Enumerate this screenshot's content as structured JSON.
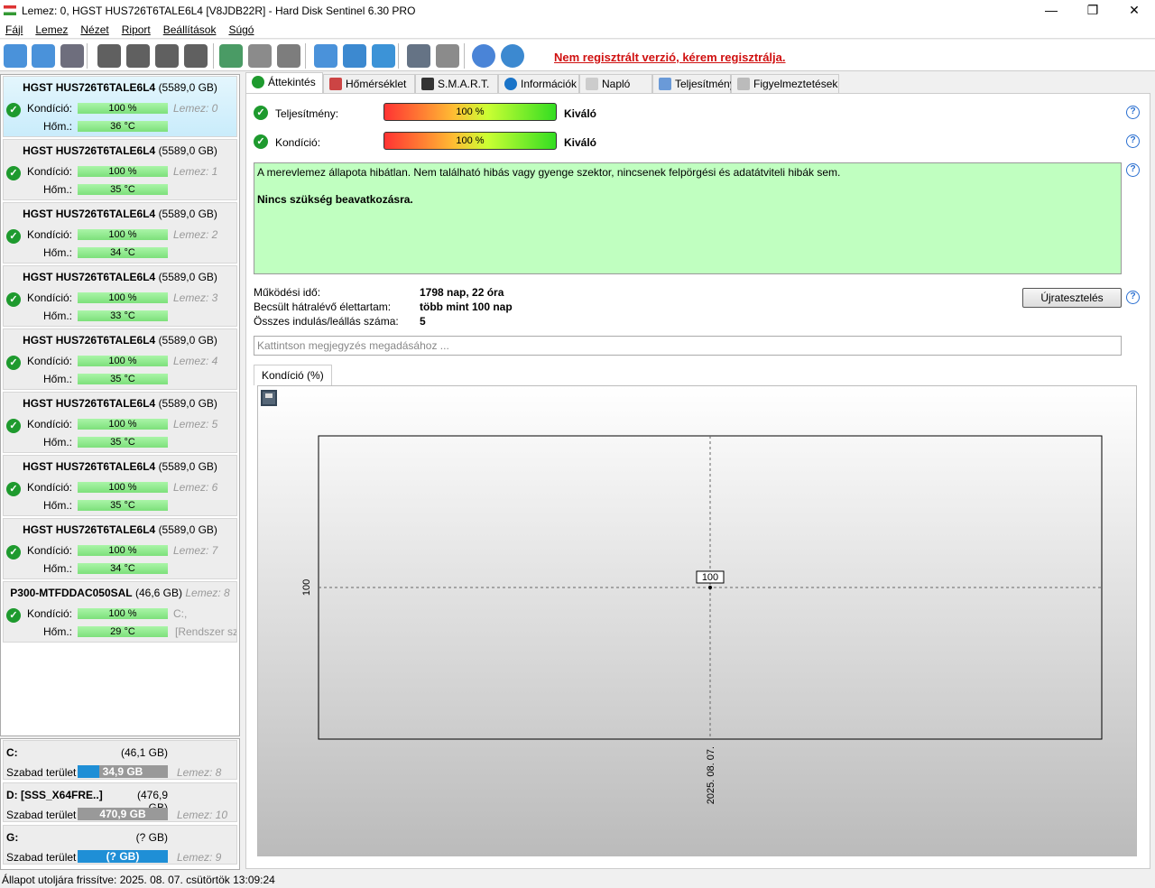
{
  "window": {
    "title": "Lemez: 0, HGST HUS726T6TALE6L4 [V8JDB22R]  -  Hard Disk Sentinel 6.30 PRO",
    "minimize": "—",
    "maximize": "❐",
    "close": "✕"
  },
  "menu": [
    "Fájl",
    "Lemez",
    "Nézet",
    "Riport",
    "Beállítások",
    "Súgó"
  ],
  "toolbar": {
    "icons": [
      "refresh-icon",
      "refresh-warning-icon",
      "disk-icon",
      "disk-sound-icon",
      "disk-clock-icon",
      "disk-check-icon",
      "disk-search-icon",
      "globe-disk-icon",
      "network-disk-icon",
      "usb-disk-icon",
      "notepad-icon",
      "mail-icon",
      "network-icon",
      "gear-icon",
      "speaker-icon",
      "help-icon",
      "info-icon"
    ],
    "registration": "Nem regisztrált verzió, kérem regisztrálja."
  },
  "disks": [
    {
      "name": "HGST HUS726T6TALE6L4",
      "size": "(5589,0 GB)",
      "condition": "100 %",
      "temp": "36 °C",
      "disk": "Lemez: 0"
    },
    {
      "name": "HGST HUS726T6TALE6L4",
      "size": "(5589,0 GB)",
      "condition": "100 %",
      "temp": "35 °C",
      "disk": "Lemez: 1"
    },
    {
      "name": "HGST HUS726T6TALE6L4",
      "size": "(5589,0 GB)",
      "condition": "100 %",
      "temp": "34 °C",
      "disk": "Lemez: 2"
    },
    {
      "name": "HGST HUS726T6TALE6L4",
      "size": "(5589,0 GB)",
      "condition": "100 %",
      "temp": "33 °C",
      "disk": "Lemez: 3"
    },
    {
      "name": "HGST HUS726T6TALE6L4",
      "size": "(5589,0 GB)",
      "condition": "100 %",
      "temp": "35 °C",
      "disk": "Lemez: 4"
    },
    {
      "name": "HGST HUS726T6TALE6L4",
      "size": "(5589,0 GB)",
      "condition": "100 %",
      "temp": "35 °C",
      "disk": "Lemez: 5"
    },
    {
      "name": "HGST HUS726T6TALE6L4",
      "size": "(5589,0 GB)",
      "condition": "100 %",
      "temp": "35 °C",
      "disk": "Lemez: 6"
    },
    {
      "name": "HGST HUS726T6TALE6L4",
      "size": "(5589,0 GB)",
      "condition": "100 %",
      "temp": "34 °C",
      "disk": "Lemez: 7"
    },
    {
      "name": "P300-MTFDDAC050SAL",
      "size": "(46,6 GB)",
      "condition": "100 %",
      "temp": "29 °C",
      "disk": "Lemez: 8",
      "extra1": "C:,",
      "extra2": "[Rendszer szá"
    }
  ],
  "labels": {
    "condition": "Kondíció:",
    "temp": "Hőm.:",
    "free": "Szabad terület"
  },
  "volumes": [
    {
      "name": "C:",
      "size": "(46,1 GB)",
      "free": "34,9 GB",
      "disk": "Lemez: 8",
      "used_fraction": 0.24
    },
    {
      "name": "D: [SSS_X64FRE..]",
      "size": "(476,9 GB)",
      "free": "470,9 GB",
      "disk": "Lemez: 10",
      "used_fraction": 0
    },
    {
      "name": "G:",
      "size": "(? GB)",
      "free": "(? GB)",
      "disk": "Lemez: 9",
      "used_fraction": 1
    }
  ],
  "tabs": [
    "Áttekintés",
    "Hőmérséklet",
    "S.M.A.R.T.",
    "Információk",
    "Napló",
    "Teljesítmény",
    "Figyelmeztetések"
  ],
  "overview": {
    "performance_label": "Teljesítmény:",
    "performance_value": "100 %",
    "performance_text": "Kiváló",
    "condition_label": "Kondíció:",
    "condition_value": "100 %",
    "condition_text": "Kiváló",
    "message1": "A merevlemez állapota hibátlan. Nem található hibás vagy gyenge szektor, nincsenek felpörgési és adatátviteli hibák sem.",
    "message2": "Nincs szükség beavatkozásra.",
    "uptime_label": "Működési idő:",
    "uptime": "1798 nap, 22 óra",
    "remaining_label": "Becsült hátralévő élettartam:",
    "remaining": "több mint 100 nap",
    "starts_label": "Összes indulás/leállás száma:",
    "starts": "5",
    "retest": "Újratesztelés",
    "note_placeholder": "Kattintson megjegyzés megadásához ..."
  },
  "chart_tab": "Kondíció  (%)",
  "chart_data": {
    "type": "line",
    "x": [
      "2025. 08. 07."
    ],
    "values": [
      100
    ],
    "data_labels": [
      "100"
    ],
    "ytick_labels": [
      "100"
    ],
    "xtick_labels": [
      "2025. 08. 07."
    ],
    "grid": true
  },
  "status": "Állapot utoljára frissítve: 2025. 08. 07. csütörtök 13:09:24"
}
